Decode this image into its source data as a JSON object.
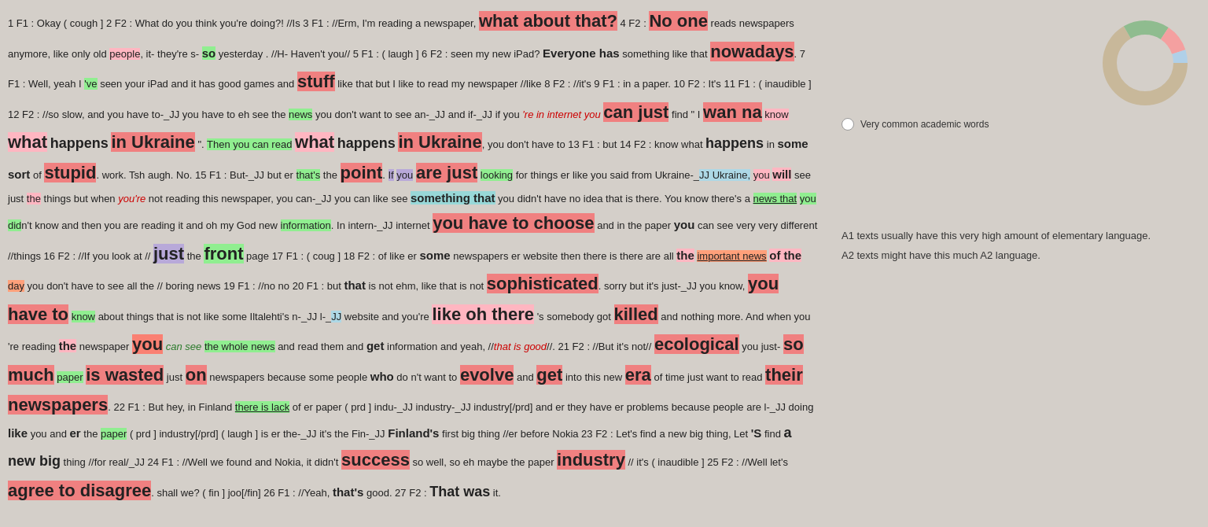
{
  "sidebar": {
    "legend_label": "Very common academic words",
    "a1_description": "A1 texts usually have this very high amount of elementary language.",
    "a2_description": "A2 texts might have this much A2 language."
  }
}
